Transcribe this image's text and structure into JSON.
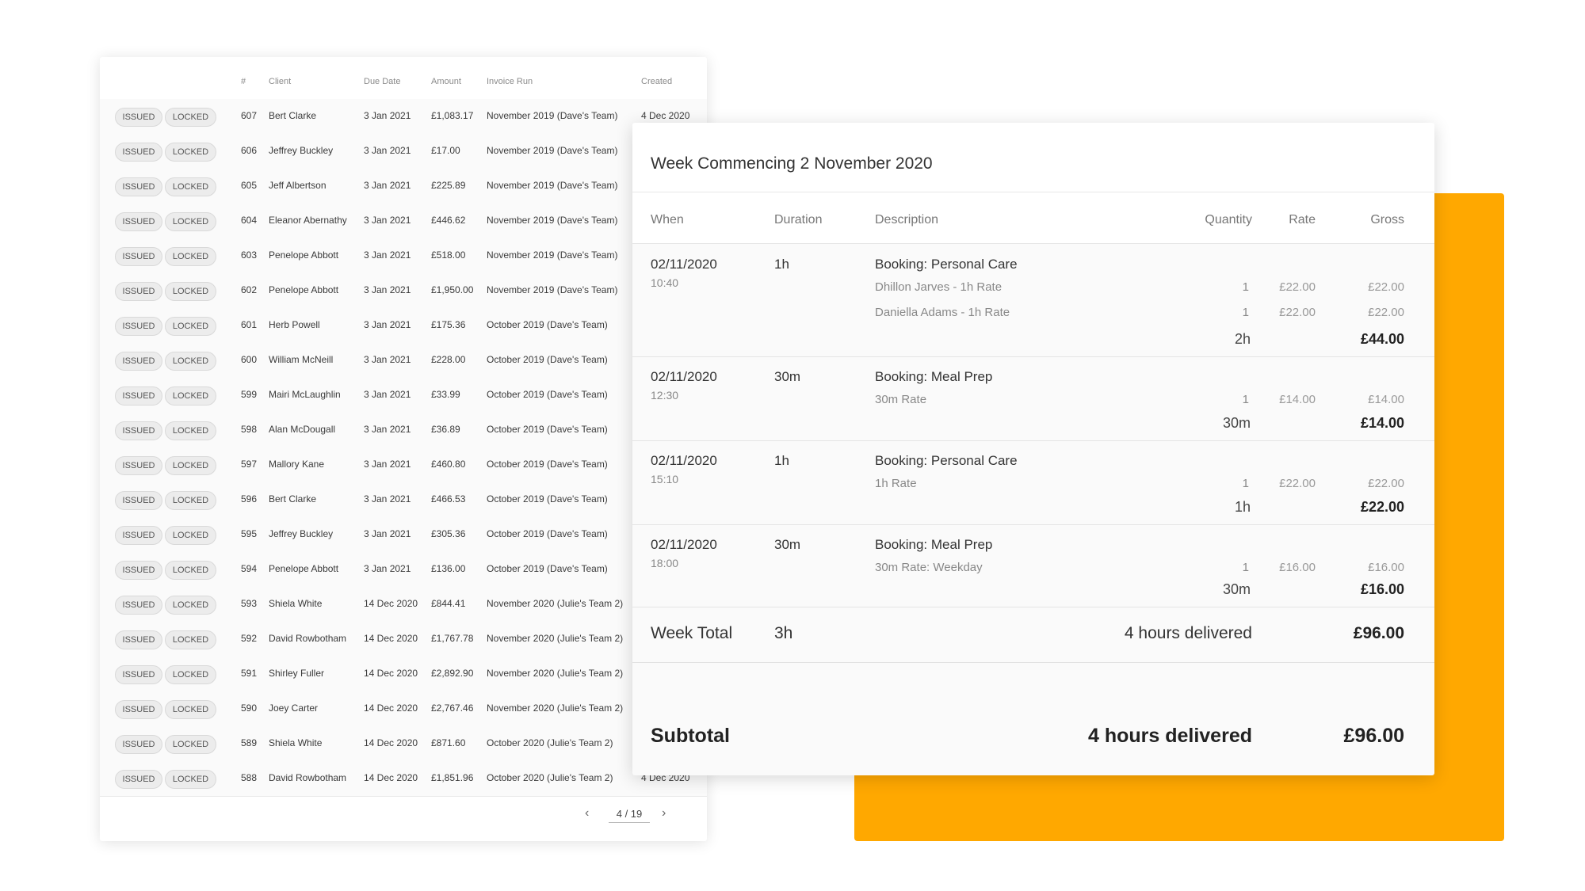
{
  "colors": {
    "accent": "#FFA800",
    "card_bg": "#ffffff",
    "row_bg": "#fafafa",
    "pill_bg": "#ececec"
  },
  "invoices": {
    "columns": {
      "num": "#",
      "client": "Client",
      "due_date": "Due Date",
      "amount": "Amount",
      "invoice_run": "Invoice Run",
      "created": "Created"
    },
    "rows": [
      {
        "status": "ISSUED",
        "lock": "LOCKED",
        "num": "607",
        "client": "Bert Clarke",
        "due": "3 Jan 2021",
        "amount": "£1,083.17",
        "run": "November 2019 (Dave's Team)",
        "created": "4 Dec 2020"
      },
      {
        "status": "ISSUED",
        "lock": "LOCKED",
        "num": "606",
        "client": "Jeffrey Buckley",
        "due": "3 Jan 2021",
        "amount": "£17.00",
        "run": "November 2019 (Dave's Team)",
        "created": ""
      },
      {
        "status": "ISSUED",
        "lock": "LOCKED",
        "num": "605",
        "client": "Jeff Albertson",
        "due": "3 Jan 2021",
        "amount": "£225.89",
        "run": "November 2019 (Dave's Team)",
        "created": ""
      },
      {
        "status": "ISSUED",
        "lock": "LOCKED",
        "num": "604",
        "client": "Eleanor Abernathy",
        "due": "3 Jan 2021",
        "amount": "£446.62",
        "run": "November 2019 (Dave's Team)",
        "created": ""
      },
      {
        "status": "ISSUED",
        "lock": "LOCKED",
        "num": "603",
        "client": "Penelope Abbott",
        "due": "3 Jan 2021",
        "amount": "£518.00",
        "run": "November 2019 (Dave's Team)",
        "created": ""
      },
      {
        "status": "ISSUED",
        "lock": "LOCKED",
        "num": "602",
        "client": "Penelope Abbott",
        "due": "3 Jan 2021",
        "amount": "£1,950.00",
        "run": "November 2019 (Dave's Team)",
        "created": ""
      },
      {
        "status": "ISSUED",
        "lock": "LOCKED",
        "num": "601",
        "client": "Herb Powell",
        "due": "3 Jan 2021",
        "amount": "£175.36",
        "run": "October 2019 (Dave's Team)",
        "created": ""
      },
      {
        "status": "ISSUED",
        "lock": "LOCKED",
        "num": "600",
        "client": "William McNeill",
        "due": "3 Jan 2021",
        "amount": "£228.00",
        "run": "October 2019 (Dave's Team)",
        "created": ""
      },
      {
        "status": "ISSUED",
        "lock": "LOCKED",
        "num": "599",
        "client": "Mairi McLaughlin",
        "due": "3 Jan 2021",
        "amount": "£33.99",
        "run": "October 2019 (Dave's Team)",
        "created": ""
      },
      {
        "status": "ISSUED",
        "lock": "LOCKED",
        "num": "598",
        "client": "Alan McDougall",
        "due": "3 Jan 2021",
        "amount": "£36.89",
        "run": "October 2019 (Dave's Team)",
        "created": ""
      },
      {
        "status": "ISSUED",
        "lock": "LOCKED",
        "num": "597",
        "client": "Mallory Kane",
        "due": "3 Jan 2021",
        "amount": "£460.80",
        "run": "October 2019 (Dave's Team)",
        "created": ""
      },
      {
        "status": "ISSUED",
        "lock": "LOCKED",
        "num": "596",
        "client": "Bert Clarke",
        "due": "3 Jan 2021",
        "amount": "£466.53",
        "run": "October 2019 (Dave's Team)",
        "created": ""
      },
      {
        "status": "ISSUED",
        "lock": "LOCKED",
        "num": "595",
        "client": "Jeffrey Buckley",
        "due": "3 Jan 2021",
        "amount": "£305.36",
        "run": "October 2019 (Dave's Team)",
        "created": ""
      },
      {
        "status": "ISSUED",
        "lock": "LOCKED",
        "num": "594",
        "client": "Penelope Abbott",
        "due": "3 Jan 2021",
        "amount": "£136.00",
        "run": "October 2019 (Dave's Team)",
        "created": ""
      },
      {
        "status": "ISSUED",
        "lock": "LOCKED",
        "num": "593",
        "client": "Shiela White",
        "due": "14 Dec 2020",
        "amount": "£844.41",
        "run": "November 2020 (Julie's Team 2)",
        "created": ""
      },
      {
        "status": "ISSUED",
        "lock": "LOCKED",
        "num": "592",
        "client": "David Rowbotham",
        "due": "14 Dec 2020",
        "amount": "£1,767.78",
        "run": "November 2020 (Julie's Team 2)",
        "created": ""
      },
      {
        "status": "ISSUED",
        "lock": "LOCKED",
        "num": "591",
        "client": "Shirley Fuller",
        "due": "14 Dec 2020",
        "amount": "£2,892.90",
        "run": "November 2020 (Julie's Team 2)",
        "created": ""
      },
      {
        "status": "ISSUED",
        "lock": "LOCKED",
        "num": "590",
        "client": "Joey Carter",
        "due": "14 Dec 2020",
        "amount": "£2,767.46",
        "run": "November 2020 (Julie's Team 2)",
        "created": ""
      },
      {
        "status": "ISSUED",
        "lock": "LOCKED",
        "num": "589",
        "client": "Shiela White",
        "due": "14 Dec 2020",
        "amount": "£871.60",
        "run": "October 2020 (Julie's Team 2)",
        "created": ""
      },
      {
        "status": "ISSUED",
        "lock": "LOCKED",
        "num": "588",
        "client": "David Rowbotham",
        "due": "14 Dec 2020",
        "amount": "£1,851.96",
        "run": "October 2020 (Julie's Team 2)",
        "created": "4 Dec 2020"
      }
    ],
    "pagination": {
      "prev_icon": "‹",
      "indicator": "4 / 19",
      "next_icon": "›"
    }
  },
  "timesheet": {
    "title": "Week Commencing 2 November 2020",
    "columns": {
      "when": "When",
      "duration": "Duration",
      "description": "Description",
      "quantity": "Quantity",
      "rate": "Rate",
      "gross": "Gross"
    },
    "bookings": [
      {
        "date": "02/11/2020",
        "time": "10:40",
        "duration": "1h",
        "title": "Booking: Personal Care",
        "lines": [
          {
            "desc": "Dhillon Jarves - 1h Rate",
            "qty": "1",
            "rate": "£22.00",
            "gross": "£22.00"
          },
          {
            "desc": "Daniella Adams - 1h Rate",
            "qty": "1",
            "rate": "£22.00",
            "gross": "£22.00"
          }
        ],
        "total_qty": "2h",
        "total_gross": "£44.00"
      },
      {
        "date": "02/11/2020",
        "time": "12:30",
        "duration": "30m",
        "title": "Booking: Meal Prep",
        "lines": [
          {
            "desc": "30m Rate",
            "qty": "1",
            "rate": "£14.00",
            "gross": "£14.00"
          }
        ],
        "total_qty": "30m",
        "total_gross": "£14.00"
      },
      {
        "date": "02/11/2020",
        "time": "15:10",
        "duration": "1h",
        "title": "Booking: Personal Care",
        "lines": [
          {
            "desc": "1h Rate",
            "qty": "1",
            "rate": "£22.00",
            "gross": "£22.00"
          }
        ],
        "total_qty": "1h",
        "total_gross": "£22.00"
      },
      {
        "date": "02/11/2020",
        "time": "18:00",
        "duration": "30m",
        "title": "Booking: Meal Prep",
        "lines": [
          {
            "desc": "30m Rate: Weekday",
            "qty": "1",
            "rate": "£16.00",
            "gross": "£16.00"
          }
        ],
        "total_qty": "30m",
        "total_gross": "£16.00"
      }
    ],
    "week_total": {
      "label": "Week Total",
      "duration": "3h",
      "hours": "4 hours delivered",
      "gross": "£96.00"
    },
    "subtotal": {
      "label": "Subtotal",
      "hours": "4 hours delivered",
      "gross": "£96.00"
    }
  }
}
